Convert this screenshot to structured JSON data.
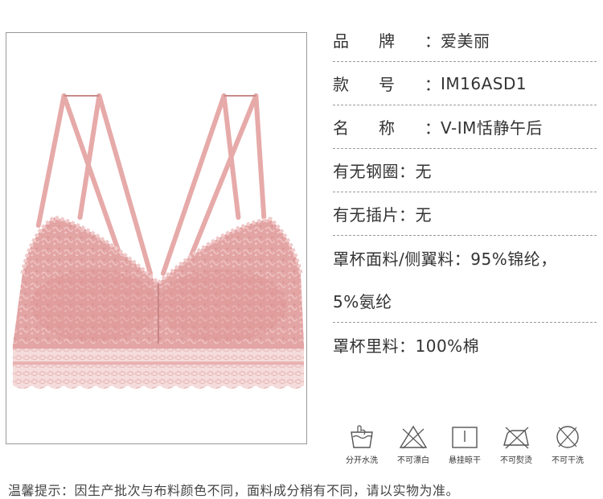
{
  "specs": {
    "brand": {
      "label": "品牌：",
      "value": "爱美丽"
    },
    "model": {
      "label": "款号：",
      "value": "IM16ASD1"
    },
    "name": {
      "label": "名称：",
      "value": "V-IM恬静午后"
    },
    "steel_ring": {
      "label": "有无钢圈：",
      "value": "无"
    },
    "insert": {
      "label": "有无插片：",
      "value": "无"
    },
    "cup_fabric": {
      "label": "罩杯面料/侧翼料：",
      "value": "95%锦纶，",
      "continuation": "5%氨纶"
    },
    "cup_lining": {
      "label": "罩杯里料：",
      "value": "100%棉"
    }
  },
  "care": [
    {
      "icon": "hand-wash-icon",
      "label": "分开水洗"
    },
    {
      "icon": "no-bleach-icon",
      "label": "不可漂白"
    },
    {
      "icon": "hang-dry-icon",
      "label": "悬挂晾干"
    },
    {
      "icon": "no-iron-icon",
      "label": "不可熨烫"
    },
    {
      "icon": "no-dry-clean-icon",
      "label": "不可干洗"
    }
  ],
  "footer": {
    "note": "温馨提示：因生产批次与布料颜色不同，面料成分稍有不同，请以实物为准。"
  },
  "colors": {
    "product_pink": "#e3a4a4",
    "lace_light": "#f3dada",
    "divider": "#9a9a9a"
  }
}
